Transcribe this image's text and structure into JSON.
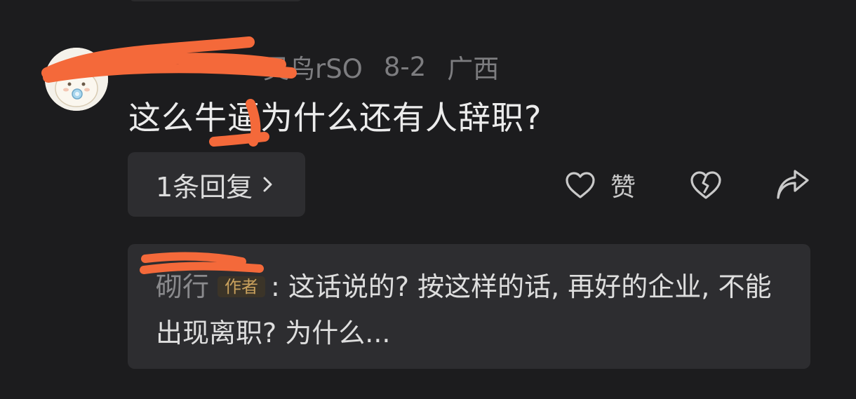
{
  "comment": {
    "username_visible": "灵鸟rSO",
    "date": "8-2",
    "location": "广西",
    "text": "这么牛逼为什么还有人辞职?",
    "replies_label": "1条回复",
    "like_label": "赞"
  },
  "reply_preview": {
    "author": "砌行",
    "badge": "作者",
    "text": ": 这话说的? 按这样的话, 再好的企业, 不能出现离职? 为什么..."
  },
  "icons": {
    "avatar": "cartoon-cat-avatar",
    "replies_chevron": "chevron-right-icon",
    "like": "heart-outline-icon",
    "dislike": "broken-heart-icon",
    "share": "share-arrow-icon"
  },
  "colors": {
    "background": "#1c1c1e",
    "card": "#2d2d30",
    "redaction": "#f4693a",
    "badge_text": "#c9a15d"
  }
}
